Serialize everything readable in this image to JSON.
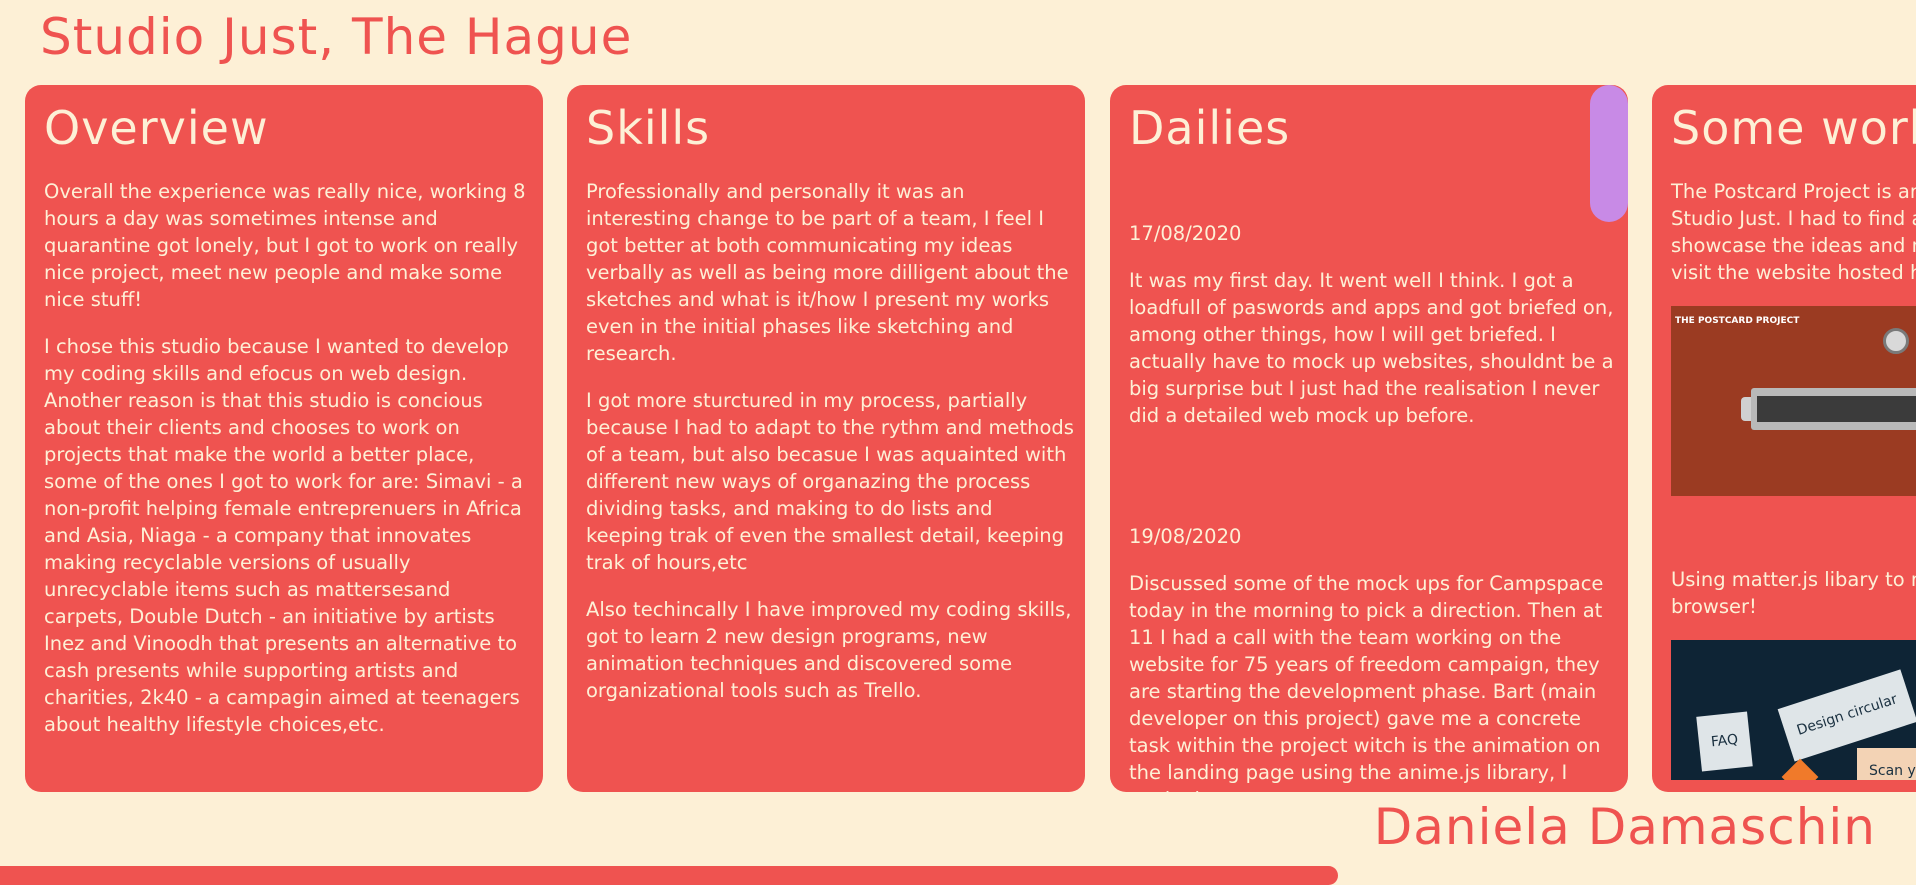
{
  "site_title": "Studio Just, The Hague",
  "author": "Daniela Damaschin",
  "colors": {
    "background": "#fdf0d6",
    "card": "#ef5350",
    "card_text": "#fdf0d6",
    "scroll_thumb": "#c88ae6"
  },
  "cards": {
    "overview": {
      "title": "Overview",
      "paragraphs": [
        "Overall the experience was really nice, working 8 hours a day was sometimes intense and quarantine got lonely, but I got to work on really nice project, meet new people and make some nice stuff!",
        "I chose this studio because I wanted to develop my coding skills and efocus on web design. Another reason is that this studio is concious about their clients and chooses to work on projects that make the world a better place, some of the ones I got to work for are: Simavi - a non-profit helping female entreprenuers in Africa and Asia, Niaga - a company that innovates making recyclable versions of usually unrecyclable items such as mattersesand carpets, Double Dutch - an initiative by artists Inez and Vinoodh that presents an alternative to cash presents while supporting artists and charities, 2k40 - a campagin aimed at teenagers about healthy lifestyle choices,etc."
      ]
    },
    "skills": {
      "title": "Skills",
      "paragraphs": [
        "Professionally and personally it was an interesting change to be part of a team, I feel I got better at both communicating my ideas verbally as well as being more dilligent about the sketches and what is it/how I present my works even in the initial phases like sketching and research.",
        "I got more sturctured in my process, partially because I had to adapt to the rythm and methods of a team, but also becasue I was aquainted with different new ways of organazing the process dividing tasks, and making to do lists and keeping trak of even the smallest detail, keeping trak of hours,etc",
        "Also techincally I have improved my coding skills, got to learn 2 new design programs, new animation techniques and discovered some organizational tools such as Trello."
      ]
    },
    "dailies": {
      "title": "Dailies",
      "entries": [
        {
          "date": "17/08/2020",
          "text": "It was my first day. It went well I think. I got a loadfull of paswords and apps and got briefed on, among other things, how I will get briefed. I actually have to mock up websites, shouldnt be a big surprise but I just had the realisation I never did a detailed web mock up before."
        },
        {
          "date": "19/08/2020",
          "text": "Discussed some of the mock ups for Campspace today in the morning to pick a direction. Then at 11 I had a call with the team working on the website for 75 years of freedom campaign, they are starting the development phase. Bart (main developer on this project) gave me a concrete task within the project witch is the animation on the landing page using the anime.js library, I worked on"
        }
      ]
    },
    "work": {
      "title": "Some work",
      "text_1": "The Postcard Project is an initiative made by Studio Just. I had to find a way to digitally showcase the ideas and make it happen. You can visit the website hosted here.",
      "postcard_label": "THE POSTCARD PROJECT",
      "text_2": "Using matter.js libary to make physics within a browser!",
      "tags": {
        "faq": "FAQ",
        "design": "Design circular",
        "scan": "Scan your"
      }
    }
  }
}
